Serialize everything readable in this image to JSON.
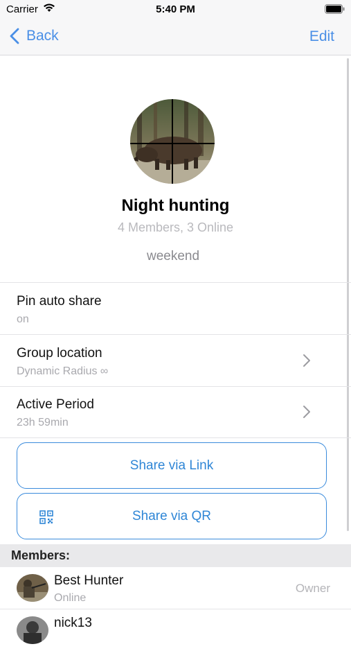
{
  "status_bar": {
    "carrier": "Carrier",
    "time": "5:40 PM"
  },
  "nav": {
    "back_label": "Back",
    "edit_label": "Edit"
  },
  "group": {
    "name": "Night hunting",
    "members_summary": "4 Members, 3 Online",
    "description": "weekend"
  },
  "settings": [
    {
      "title": "Pin auto share",
      "subtitle": "on"
    },
    {
      "title": "Group location",
      "subtitle": "Dynamic Radius ∞"
    },
    {
      "title": "Active Period",
      "subtitle": "23h 59min"
    }
  ],
  "share": {
    "link_label": "Share via Link",
    "qr_label": "Share via QR"
  },
  "members_section": {
    "header": "Members:"
  },
  "members": [
    {
      "name": "Best Hunter",
      "status": "Online",
      "role": "Owner"
    },
    {
      "name": "nick13",
      "status": "",
      "role": ""
    }
  ],
  "colors": {
    "accent": "#4a8fe6",
    "button_border": "#3a8bdc",
    "secondary_text": "#a9a9ae"
  }
}
